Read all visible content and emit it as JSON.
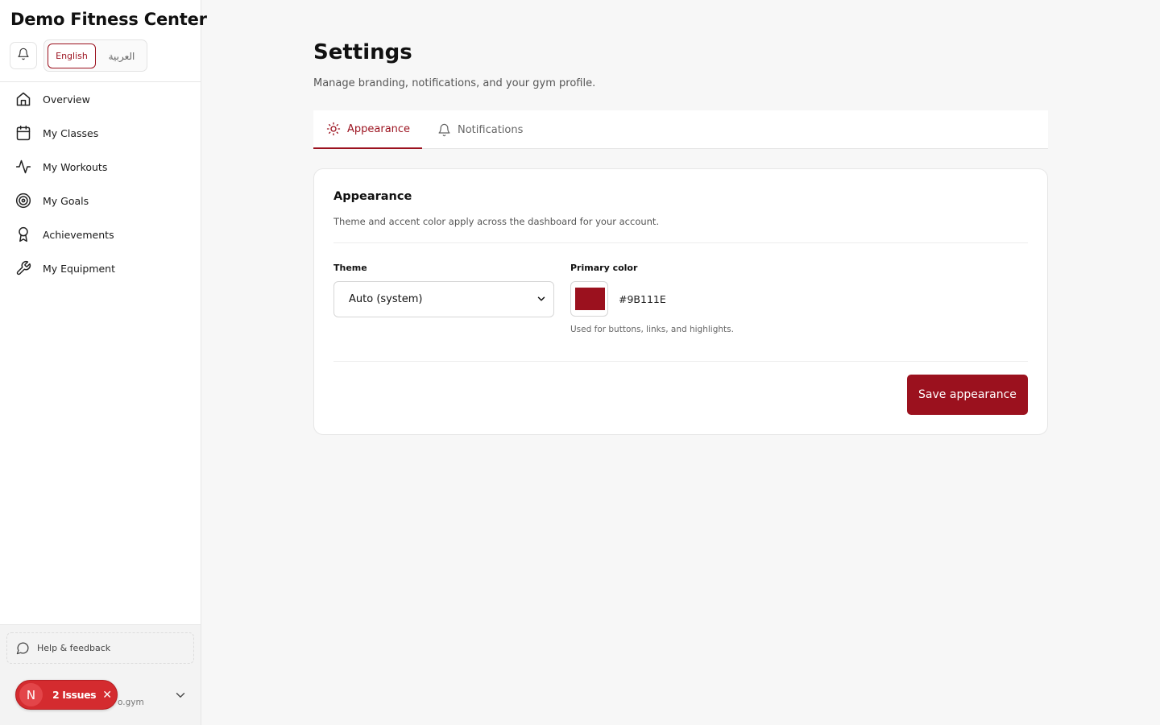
{
  "sidebar": {
    "brand": "Demo Fitness Center",
    "language": {
      "english": "English",
      "arabic": "العربية"
    },
    "nav": [
      {
        "label": "Overview",
        "icon": "home-icon"
      },
      {
        "label": "My Classes",
        "icon": "calendar-icon"
      },
      {
        "label": "My Workouts",
        "icon": "activity-icon"
      },
      {
        "label": "My Goals",
        "icon": "target-icon"
      },
      {
        "label": "Achievements",
        "icon": "award-icon"
      },
      {
        "label": "My Equipment",
        "icon": "wrench-icon"
      }
    ],
    "help_label": "Help & feedback",
    "user_email_fragment": "o.gym"
  },
  "issues_badge": {
    "initial": "N",
    "label": "2 Issues"
  },
  "page": {
    "title": "Settings",
    "subtitle": "Manage branding, notifications, and your gym profile."
  },
  "tabs": [
    {
      "label": "Appearance",
      "icon": "sun-icon",
      "active": true
    },
    {
      "label": "Notifications",
      "icon": "bell-icon",
      "active": false
    }
  ],
  "appearance": {
    "title": "Appearance",
    "description": "Theme and accent color apply across the dashboard for your account.",
    "theme_label": "Theme",
    "theme_value": "Auto (system)",
    "primary_color_label": "Primary color",
    "primary_color_value": "#9B111E",
    "primary_color_help": "Used for buttons, links, and highlights.",
    "save_label": "Save appearance"
  },
  "colors": {
    "accent": "#9B111E",
    "issues_red": "#d42b2f"
  }
}
